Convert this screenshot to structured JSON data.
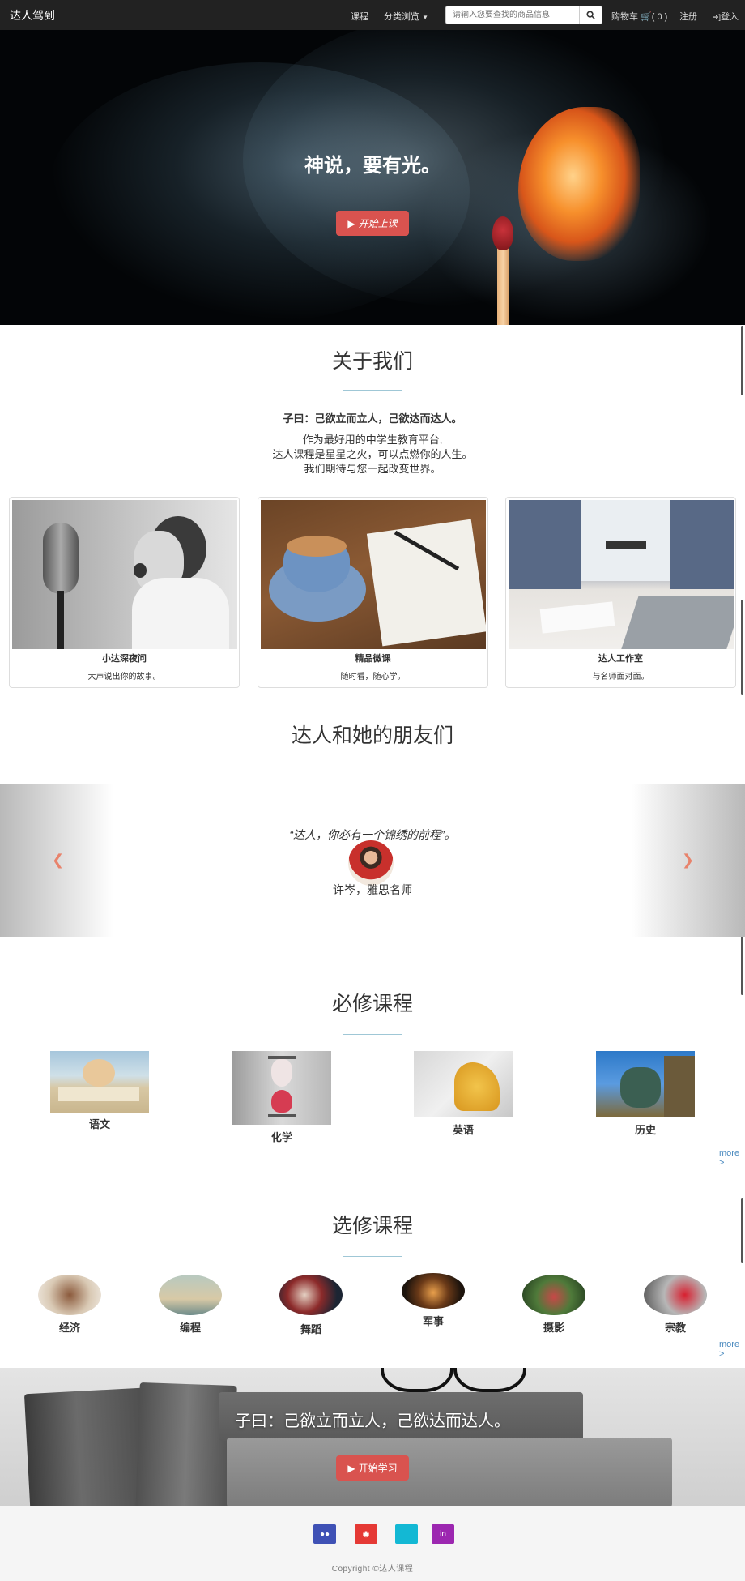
{
  "nav": {
    "brand": "达人驾到",
    "courses": "课程",
    "browse": "分类浏览",
    "search_placeholder": "请输入您要查找的商品信息",
    "cart": "购物车",
    "cart_count": "( 0 )",
    "register": "注册",
    "login": "登入"
  },
  "hero": {
    "title": "神说，要有光。",
    "button": "开始上课"
  },
  "about": {
    "title": "关于我们",
    "quote": "子曰：己欲立而立人，己欲达而达人。",
    "lines": [
      "作为最好用的中学生教育平台,",
      "达人课程是星星之火，可以点燃你的人生。",
      "我们期待与您一起改变世界。"
    ],
    "cards": [
      {
        "title": "小达深夜问",
        "text": "大声说出你的故事。"
      },
      {
        "title": "精品微课",
        "text": "随时看，随心学。"
      },
      {
        "title": "达人工作室",
        "text": "与名师面对面。"
      }
    ]
  },
  "friends": {
    "title": "达人和她的朋友们",
    "quote": "“达人，你必有一个锦绣的前程”。",
    "author": "许岑，雅思名师"
  },
  "required": {
    "title": "必修课程",
    "courses": [
      "语文",
      "化学",
      "英语",
      "历史"
    ],
    "more": "more >"
  },
  "elective": {
    "title": "选修课程",
    "courses": [
      "经济",
      "编程",
      "舞蹈",
      "军事",
      "摄影",
      "宗教"
    ],
    "more": "more >"
  },
  "banner": {
    "title": "子曰：己欲立而立人，己欲达而达人。",
    "button": "开始学习"
  },
  "footer": {
    "copyright": "Copyright ©达人课程"
  }
}
